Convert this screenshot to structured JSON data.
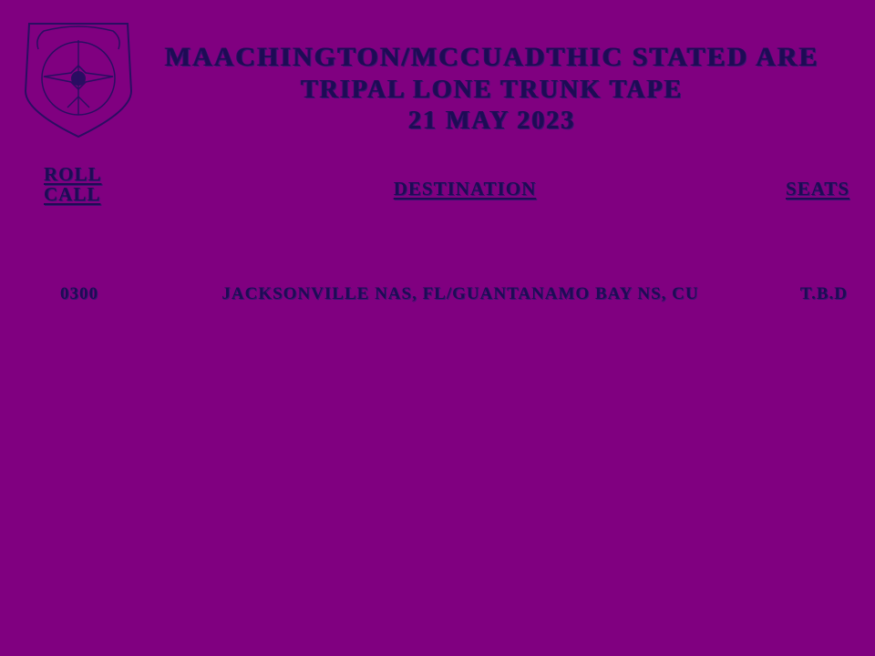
{
  "header": {
    "title_lines": [
      "MAACHINGTON/MCCUADTHIC STATED ARE",
      "TRIPAL LONE TRUNK TAPE",
      "21 MAY 2023"
    ]
  },
  "columns": {
    "roll_call": [
      "ROLL",
      "CALL"
    ],
    "destination": "DESTINATION",
    "seats": "SEATS"
  },
  "rows": [
    {
      "roll_call": "0300",
      "destination": "JACKSONVILLE NAS, FL/GUANTANAMO BAY NS, CU",
      "seats": "T.B.D"
    }
  ],
  "colors": {
    "background": "#800080",
    "ink": "#1e0b55"
  },
  "emblem": {
    "icon": "shield-emblem-icon"
  }
}
